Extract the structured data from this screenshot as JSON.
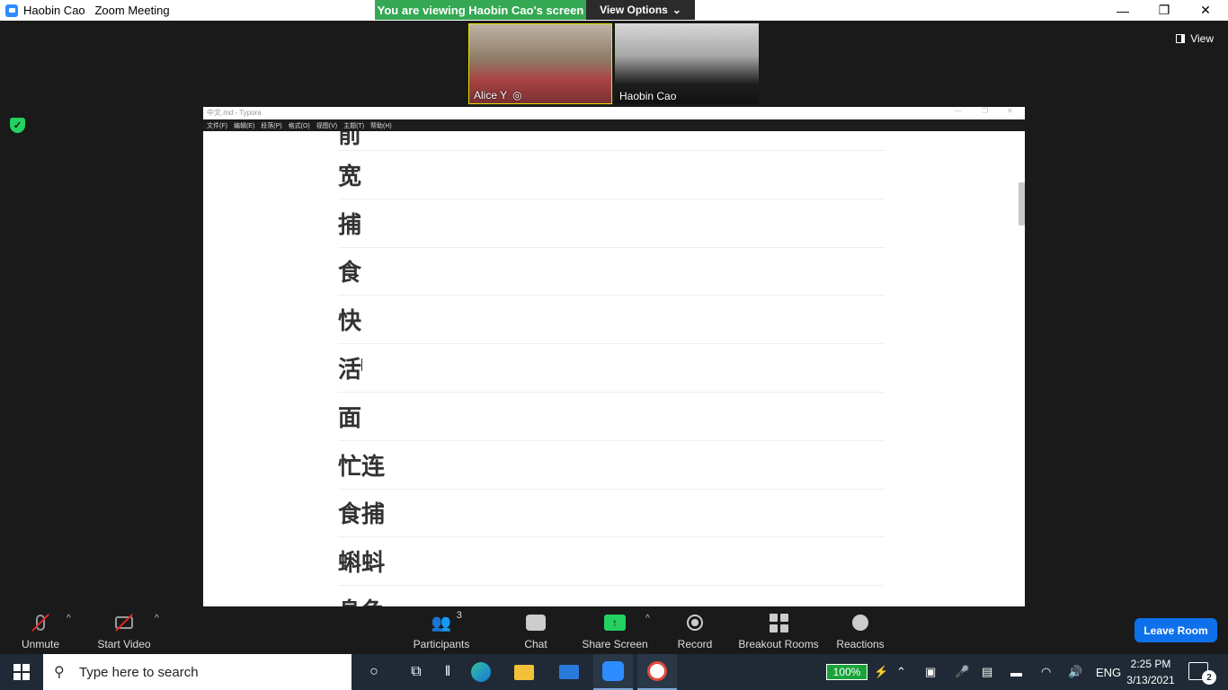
{
  "window": {
    "title": "Haobin Cao   Zoom Meeting",
    "minimize": "—",
    "maximize": "❐",
    "close": "✕"
  },
  "banner": {
    "viewing": "You are viewing Haobin Cao's screen",
    "view_options": "View Options"
  },
  "participants_strip": [
    {
      "name": "Alice   Y"
    },
    {
      "name": "Haobin Cao"
    }
  ],
  "view_button": "View",
  "shared_screen": {
    "app_title": "中文.md - Typora",
    "menu": [
      "文件(F)",
      "编辑(E)",
      "段落(P)",
      "格式(O)",
      "视图(V)",
      "主题(T)",
      "帮助(H)"
    ],
    "lines": [
      "前",
      "宽",
      "捕",
      "食",
      "快",
      "活",
      "面",
      "忙连",
      "食捕",
      "蝌蚪",
      "身色"
    ]
  },
  "toolbar": {
    "unmute": "Unmute",
    "start_video": "Start Video",
    "participants": "Participants",
    "participants_count": "3",
    "chat": "Chat",
    "share_screen": "Share Screen",
    "record": "Record",
    "breakout_rooms": "Breakout Rooms",
    "reactions": "Reactions",
    "leave": "Leave Room"
  },
  "taskbar": {
    "search_placeholder": "Type here to search",
    "battery": "100%",
    "language": "ENG",
    "time": "2:25 PM",
    "date": "3/13/2021",
    "notifications": "2"
  },
  "colors": {
    "banner_green": "#34a853",
    "share_green": "#23d160",
    "leave_blue": "#0e71eb",
    "zoom_blue": "#2d8cff"
  }
}
